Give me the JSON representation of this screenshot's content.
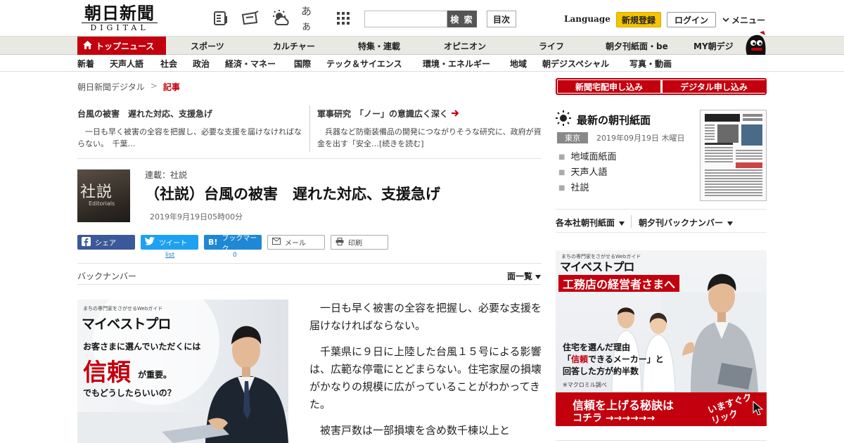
{
  "header": {
    "logo_jp": "朝日新聞",
    "logo_en": "DIGITAL",
    "icons": [
      "paper-icon",
      "news-icon",
      "weather-icon",
      "font-size-icon",
      "grid-menu-icon"
    ],
    "font_size_label": "あぁ",
    "search_placeholder": "",
    "search_button": "検 索",
    "toc_button": "目次",
    "language": "Language",
    "register": "新規登録",
    "login": "ログイン",
    "menu": "メニュー",
    "accent_color": "#c3000d",
    "register_color": "#f5c400"
  },
  "nav_primary": [
    {
      "label": "トップニュース",
      "active": true
    },
    {
      "label": "スポーツ"
    },
    {
      "label": "カルチャー"
    },
    {
      "label": "特集・連載"
    },
    {
      "label": "オピニオン"
    },
    {
      "label": "ライフ"
    },
    {
      "label": "朝夕刊紙面・be"
    },
    {
      "label": "MY朝デジ"
    }
  ],
  "nav_secondary": [
    "新着",
    "天声人語",
    "社会",
    "政治",
    "経済・マネー",
    "国際",
    "テック＆サイエンス",
    "環境・エネルギー",
    "地域",
    "朝デジスペシャル",
    "写真・動画"
  ],
  "breadcrumb": {
    "home": "朝日新聞デジタル",
    "separator": ">",
    "current": "記事"
  },
  "related": [
    {
      "title": "台風の被害　遅れた対応、支援急げ",
      "body": "一日も早く被害の全容を把握し、必要な支援を届けなければならない。　千葉…"
    },
    {
      "title": "軍事研究　「ノー」の意識広く深く",
      "body": "兵器など防衛装備品の開発につながりそうな研究に、政府が資金を出す「安全…",
      "more": "[続きを読む]"
    }
  ],
  "article": {
    "thumb_kanji": "社説",
    "thumb_en": "Editorials",
    "series": "連載：社説",
    "title": "（社説）台風の被害　遅れた対応、支援急げ",
    "date": "2019年9月19日05時00分",
    "share_buttons": [
      {
        "label": "シェア"
      },
      {
        "label": "ツイート",
        "count": "list"
      },
      {
        "label": "ブックマーク",
        "count": "0"
      },
      {
        "label": "メール"
      },
      {
        "label": "印刷"
      }
    ],
    "backnumber": "バックナンバー",
    "list_all": "面一覧",
    "paragraphs": [
      "一日も早く被害の全容を把握し、必要な支援を届けなければならない。",
      "千葉県に９日に上陸した台風１５号による影響は、広範な停電にとどまらない。住宅家屋の損壊がかなりの規模に広がっていることがわかってきた。",
      "被害戸数は一部損壊を含め数千棟以上と"
    ]
  },
  "ad_article": {
    "small": "まちの専門家をさがせるWebガイド",
    "brand": "マイベストプロ",
    "line1": "お客さまに選んでいただくには",
    "big": "信頼",
    "line2": "が重要。",
    "line3": "でもどうしたらいいの？"
  },
  "sidebar": {
    "subscribe_paper": "新聞宅配申し込み",
    "subscribe_digital": "デジタル申し込み",
    "latest_title": "最新の朝刊紙面",
    "edition": "東京",
    "paper_date": "2019年09月19日 木曜日",
    "paper_links": [
      "地域面紙面",
      "天声人語",
      "社説"
    ],
    "dropdown_branch": "各本社朝刊紙面",
    "dropdown_back": "朝夕刊バックナンバー"
  },
  "ad_side": {
    "small": "まちの専門家をさがせるWebガイド",
    "brand": "マイベストプロ",
    "headline": "工務店の経営者さまへ",
    "text1": "住宅を選んだ理由",
    "text2_pre": "「",
    "text2_red": "信頼",
    "text2_post": "できるメーカー」と",
    "text3": "回答した方が約半数",
    "note": "※マクロミル調べ",
    "cta1": "信頼を上げる秘訣は",
    "cta2": "コチラ →→→→→→",
    "cta3": "いますぐクリック"
  }
}
